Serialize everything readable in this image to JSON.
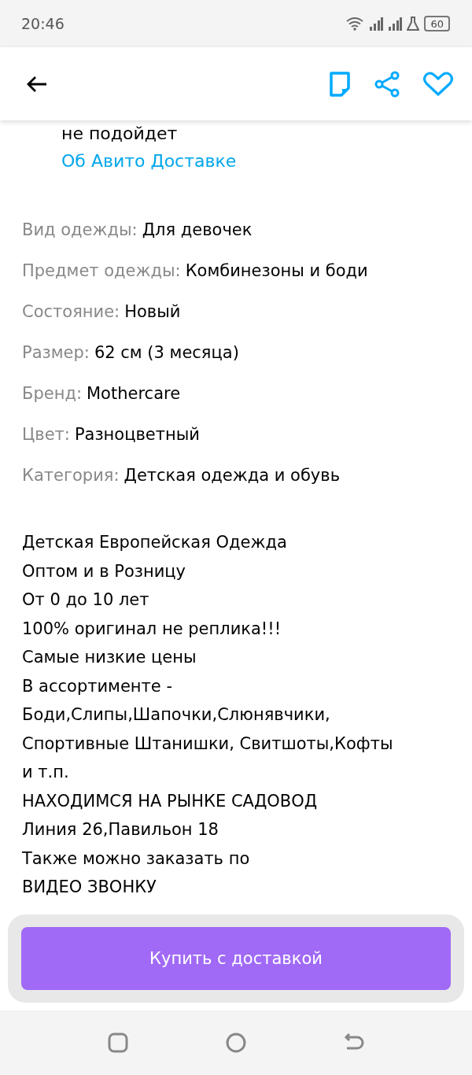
{
  "status_bar": {
    "time": "20:46",
    "battery": "60"
  },
  "delivery_note": {
    "text": "не подойдет",
    "link": "Об Авито Доставке"
  },
  "attributes": [
    {
      "label": "Вид одежды:",
      "value": "Для девочек"
    },
    {
      "label": "Предмет одежды:",
      "value": "Комбинезоны и боди"
    },
    {
      "label": "Состояние:",
      "value": "Новый"
    },
    {
      "label": "Размер:",
      "value": "62 см (3 месяца)"
    },
    {
      "label": "Бренд:",
      "value": "Mothercare"
    },
    {
      "label": "Цвет:",
      "value": "Разноцветный"
    },
    {
      "label": "Категория:",
      "value": "Детская одежда и обувь"
    }
  ],
  "description": [
    "Детская Европейская Одежда",
    "Оптом и в Розницу",
    "От 0 до 10 лет",
    "100% оригинал не реплика!!!",
    "Самые низкие цены",
    "В ассортименте -",
    "Боди,Слипы,Шапочки,Слюнявчики,",
    "Спортивные Штанишки, Свитшоты,Кофты",
    "и т.п.",
    "НАХОДИМСЯ НА РЫНКЕ САДОВОД",
    "Линия 26,Павильон 18",
    "Также можно заказать по",
    "ВИДЕО ЗВОНКУ"
  ],
  "buy_button": {
    "label": "Купить с доставкой"
  }
}
